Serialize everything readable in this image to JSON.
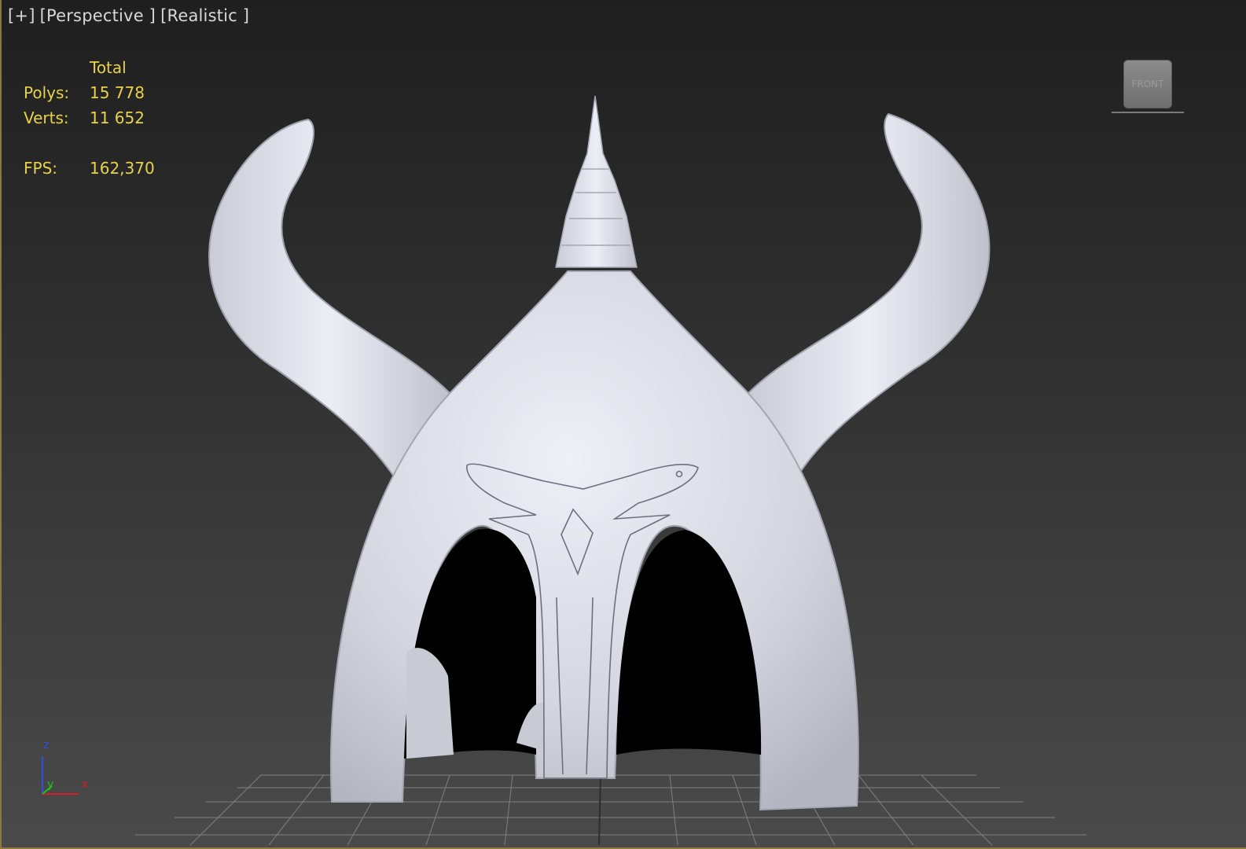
{
  "viewport": {
    "menu": "[+]",
    "view": "[Perspective ]",
    "shading": "[Realistic ]"
  },
  "stats": {
    "header": "Total",
    "polys_label": "Polys:",
    "polys_value": "15 778",
    "verts_label": "Verts:",
    "verts_value": "11 652",
    "fps_label": "FPS:",
    "fps_value": "162,370"
  },
  "viewcube": {
    "face_label": "FRONT"
  },
  "axis_gizmo": {
    "z": "z",
    "x": "x",
    "y": "y"
  },
  "colors": {
    "stats_text": "#e8d24a",
    "label_text": "#d8d8d8",
    "model": "#dcdde6",
    "axis_x": "#d02020",
    "axis_y": "#20c020",
    "axis_z": "#3050e0"
  }
}
